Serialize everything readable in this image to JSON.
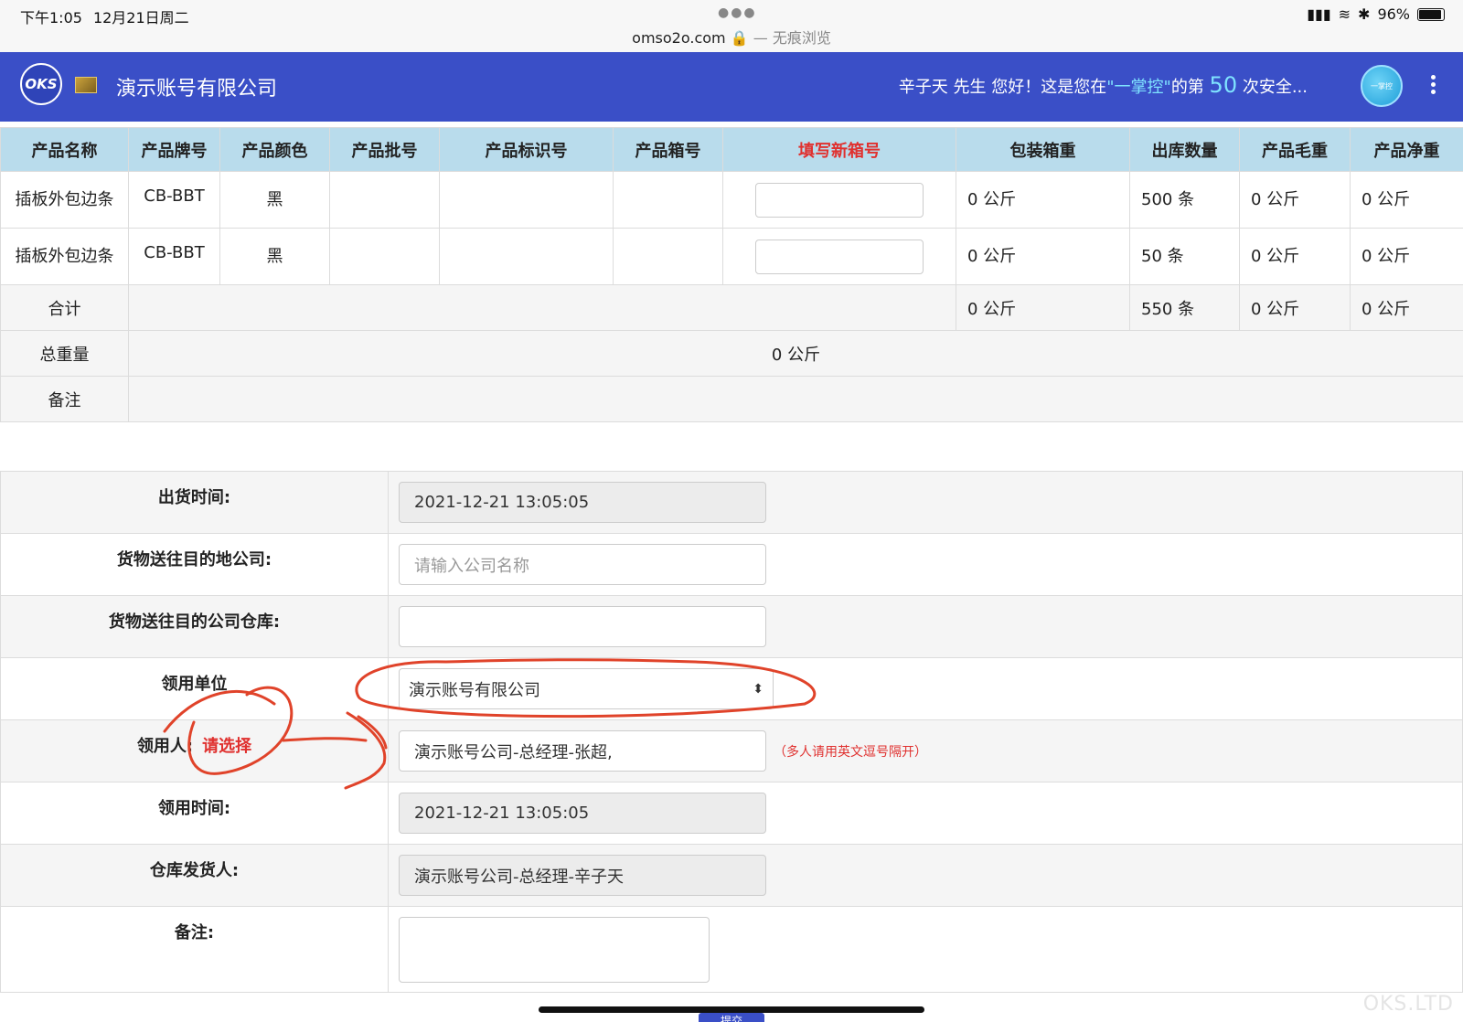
{
  "status_bar": {
    "time": "下午1:05",
    "date": "12月21日周二",
    "url": "omso2o.com",
    "private_label": "— 无痕浏览",
    "battery": "96%",
    "battery_level": 0.96
  },
  "header": {
    "logo_text": "OKS",
    "company": "演示账号有限公司",
    "greeting_prefix": "辛子天 先生 您好！这是您在",
    "brand_quoted": "\"一掌控\"",
    "greeting_mid": "的第",
    "visit_count": "50",
    "greeting_suffix": "次安全...",
    "avatar_text": "一掌控",
    "colors": {
      "bar": "#3a4fc7",
      "highlight": "#7fe3ff"
    }
  },
  "product_table": {
    "columns": [
      "产品名称",
      "产品牌号",
      "产品颜色",
      "产品批号",
      "产品标识号",
      "产品箱号",
      "填写新箱号",
      "包装箱重",
      "出库数量",
      "产品毛重",
      "产品净重"
    ],
    "rows": [
      {
        "name": "插板外包边条",
        "brand": "CB-BBT",
        "color": "黑",
        "batch": "",
        "id": "",
        "box": "",
        "new_box": "",
        "box_weight": "0 公斤",
        "qty": "500 条",
        "gross": "0 公斤",
        "net": "0 公斤"
      },
      {
        "name": "插板外包边条",
        "brand": "CB-BBT",
        "color": "黑",
        "batch": "",
        "id": "",
        "box": "",
        "new_box": "",
        "box_weight": "0 公斤",
        "qty": "50 条",
        "gross": "0 公斤",
        "net": "0 公斤"
      }
    ],
    "total": {
      "label": "合计",
      "box_weight": "0 公斤",
      "qty": "550 条",
      "gross": "0 公斤",
      "net": "0 公斤"
    },
    "total_weight": {
      "label": "总重量",
      "value": "0 公斤"
    },
    "remark": {
      "label": "备注",
      "value": ""
    }
  },
  "form": {
    "ship_time": {
      "label": "出货时间:",
      "value": "2021-12-21 13:05:05"
    },
    "dest_company": {
      "label": "货物送往目的地公司:",
      "placeholder": "请输入公司名称",
      "value": ""
    },
    "dest_warehouse": {
      "label": "货物送往目的公司仓库:",
      "value": ""
    },
    "unit": {
      "label": "领用单位",
      "value": "演示账号有限公司"
    },
    "receiver": {
      "label": "领用人:",
      "choose": "请选择",
      "value": "演示账号公司-总经理-张超,",
      "hint": "（多人请用英文逗号隔开）"
    },
    "receive_time": {
      "label": "领用时间:",
      "value": "2021-12-21 13:05:05"
    },
    "shipper": {
      "label": "仓库发货人:",
      "value": "演示账号公司-总经理-辛子天"
    },
    "remark": {
      "label": "备注:",
      "value": ""
    }
  },
  "submit_label": "提交",
  "watermark": "OKS.LTD"
}
